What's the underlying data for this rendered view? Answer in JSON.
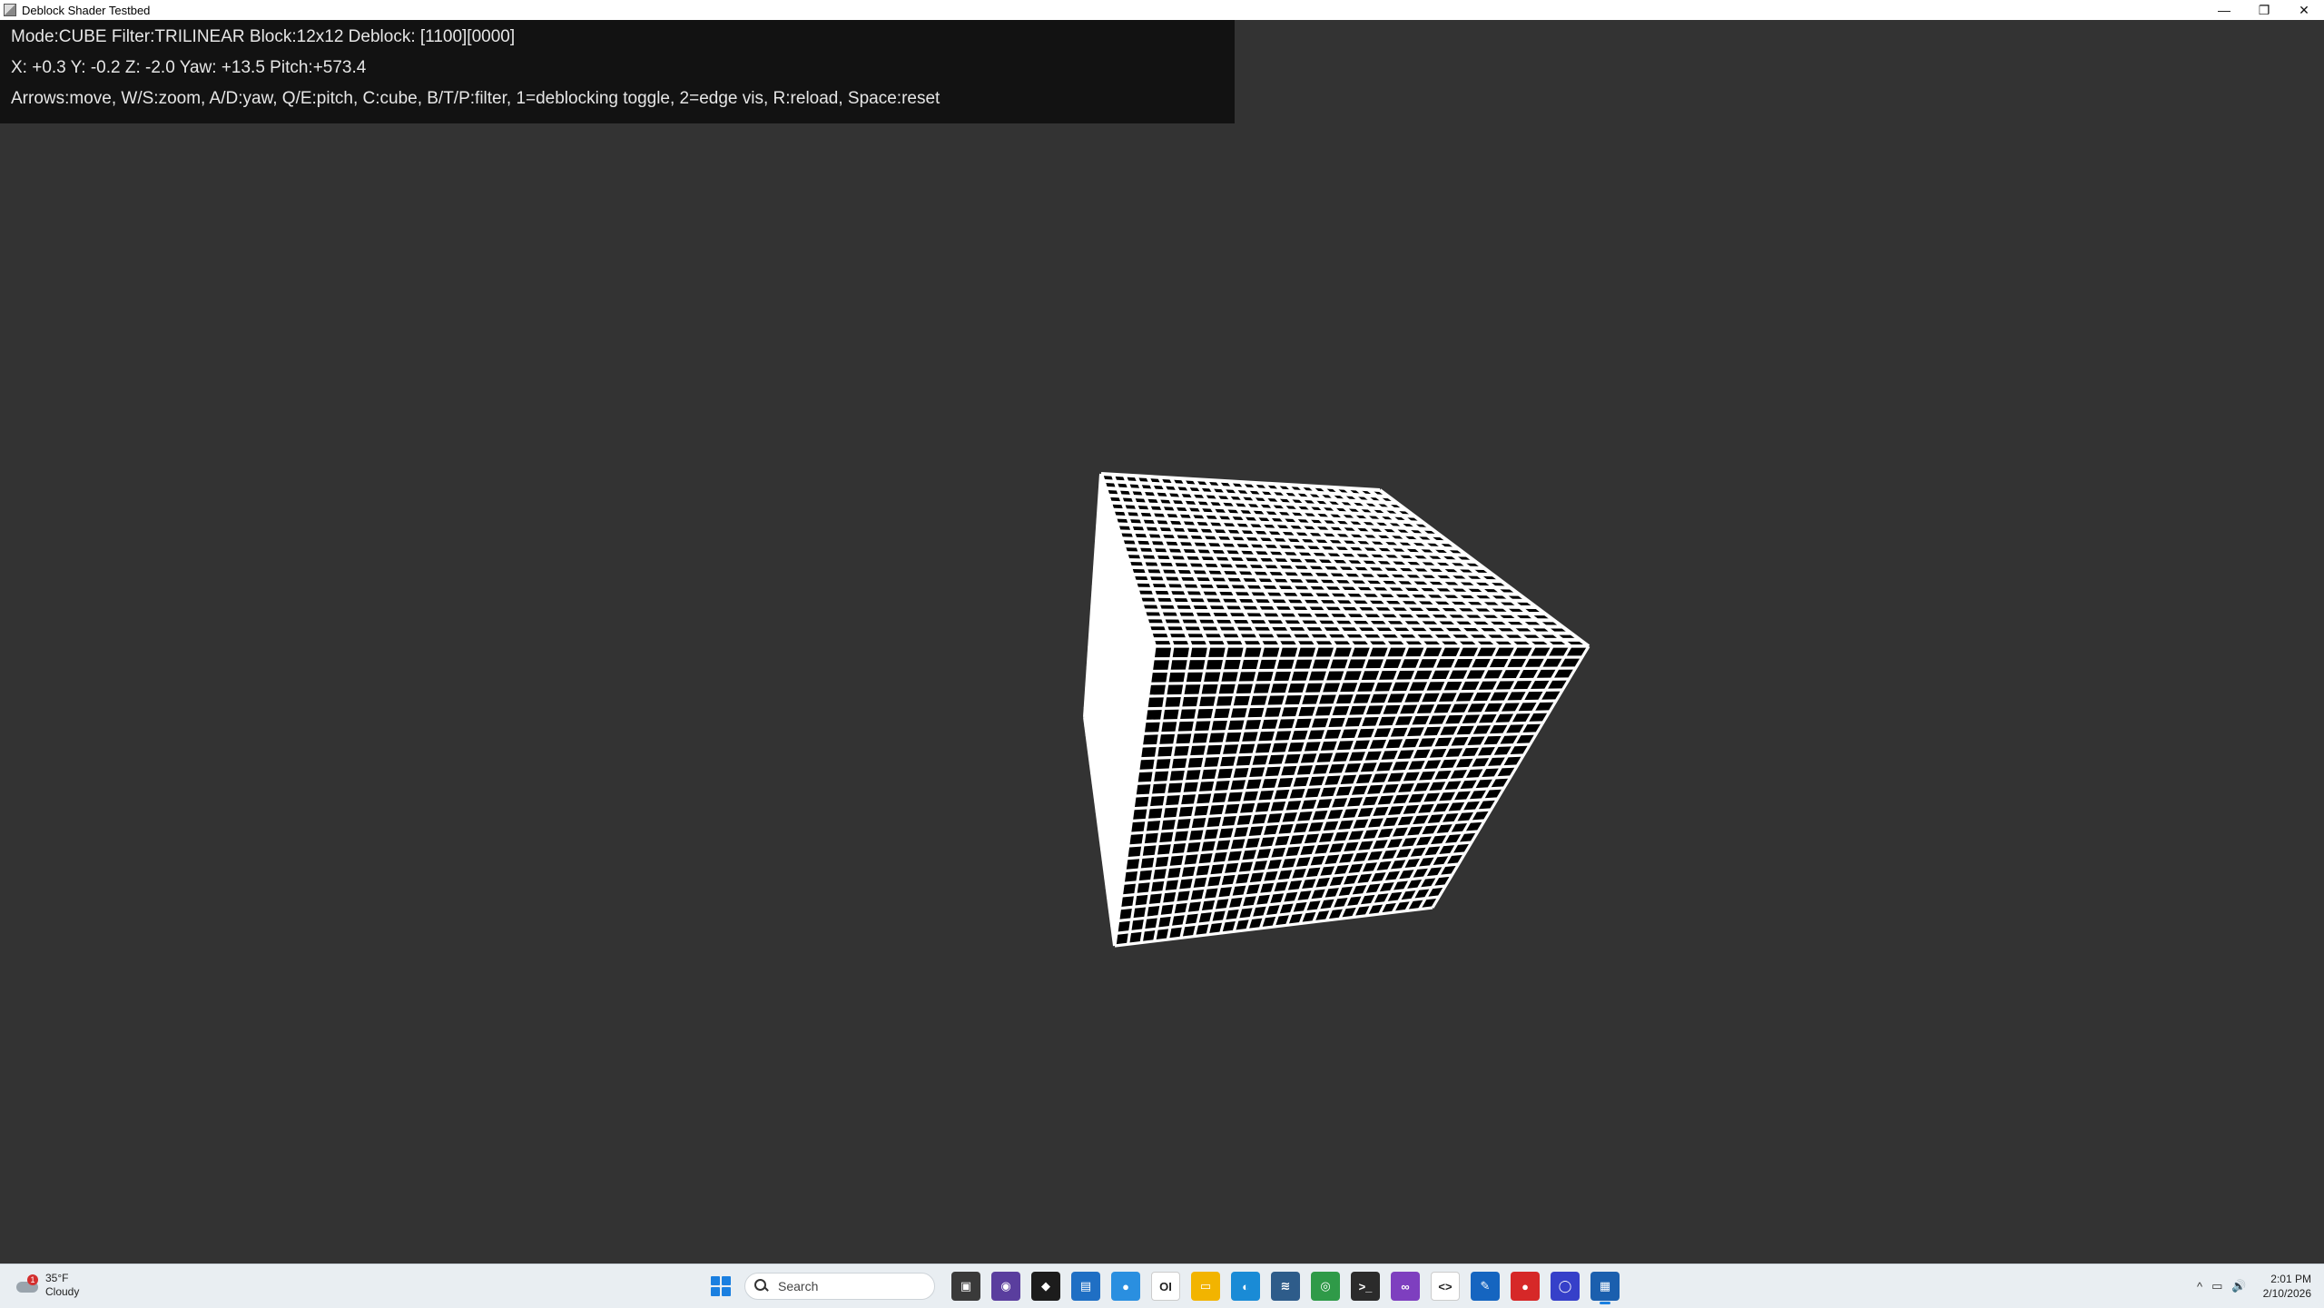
{
  "window": {
    "title": "Deblock Shader Testbed",
    "controls": {
      "minimize": "—",
      "restore": "❐",
      "close": "✕"
    }
  },
  "hud": {
    "line1": "Mode:CUBE Filter:TRILINEAR Block:12x12 Deblock: [1100][0000]",
    "line2": "X: +0.3 Y: -0.2 Z: -2.0 Yaw: +13.5 Pitch:+573.4",
    "line3": "Arrows:move, W/S:zoom, A/D:yaw, Q/E:pitch, C:cube, B/T/P:filter, 1=deblocking toggle, 2=edge vis, R:reload, Space:reset"
  },
  "scene": {
    "background": "#333333",
    "cube": {
      "grid_color": "#ffffff",
      "cell_color": "#000000",
      "cells_per_face": 24
    }
  },
  "taskbar": {
    "weather": {
      "temp": "35°F",
      "condition": "Cloudy",
      "badge": "1"
    },
    "search_label": "Search",
    "apps": [
      {
        "name": "task-view-icon",
        "color": "#3a3a3a",
        "glyph": "▣"
      },
      {
        "name": "obs-icon",
        "color": "#5a3e9e",
        "glyph": "◉"
      },
      {
        "name": "ai-app-icon",
        "color": "#1c1c1c",
        "glyph": "◆"
      },
      {
        "name": "photos-icon",
        "color": "#1f6fc4",
        "glyph": "▤"
      },
      {
        "name": "teams-icon",
        "color": "#2a8fe0",
        "glyph": "●"
      },
      {
        "name": "oi-icon",
        "color": "#ffffff",
        "glyph": "OI"
      },
      {
        "name": "file-explorer-icon",
        "color": "#f2b400",
        "glyph": "▭"
      },
      {
        "name": "edge-icon",
        "color": "#1a8bd6",
        "glyph": "◐"
      },
      {
        "name": "task-manager-icon",
        "color": "#2e5c8a",
        "glyph": "≋"
      },
      {
        "name": "chrome-icon",
        "color": "#2f9a48",
        "glyph": "◎"
      },
      {
        "name": "terminal-icon",
        "color": "#2b2b2b",
        "glyph": ">_"
      },
      {
        "name": "visual-studio-icon",
        "color": "#7e3fbf",
        "glyph": "∞"
      },
      {
        "name": "code-editor-icon",
        "color": "#ffffff",
        "glyph": "<>"
      },
      {
        "name": "paint-icon",
        "color": "#1565c0",
        "glyph": "✎"
      },
      {
        "name": "red-app-icon",
        "color": "#d62828",
        "glyph": "●"
      },
      {
        "name": "blue-circle-app-icon",
        "color": "#3640c9",
        "glyph": "◯"
      },
      {
        "name": "testbed-app-icon",
        "color": "#1b5fae",
        "glyph": "▦"
      }
    ],
    "tray": {
      "chevron": "^",
      "network": "▭",
      "volume": "🔊"
    },
    "clock": {
      "time": "2:01 PM",
      "date": "2/10/2026"
    }
  }
}
